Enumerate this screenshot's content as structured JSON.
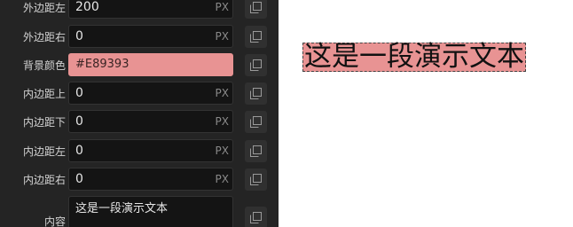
{
  "panel": {
    "rows": [
      {
        "label": "外边距左",
        "value": "200",
        "unit": "PX"
      },
      {
        "label": "外边距右",
        "value": "0",
        "unit": "PX"
      },
      {
        "label": "背景颜色",
        "value": "#E89393"
      },
      {
        "label": "内边距上",
        "value": "0",
        "unit": "PX"
      },
      {
        "label": "内边距下",
        "value": "0",
        "unit": "PX"
      },
      {
        "label": "内边距左",
        "value": "0",
        "unit": "PX"
      },
      {
        "label": "内边距右",
        "value": "0",
        "unit": "PX"
      },
      {
        "label": "内容",
        "value": "这是一段演示文本"
      }
    ],
    "copy_icon": "copy-icon"
  },
  "preview": {
    "text": "这是一段演示文本",
    "background_color": "#E89393"
  }
}
